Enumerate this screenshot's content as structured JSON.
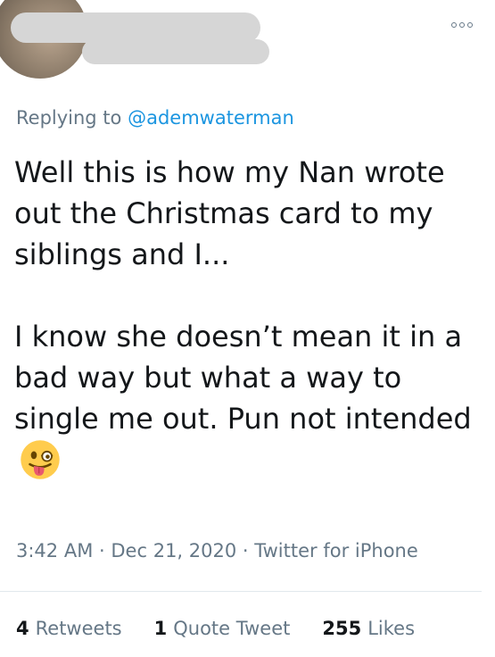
{
  "reply": {
    "prefix": "Replying to",
    "handle": "@ademwaterman"
  },
  "tweet": {
    "paragraph1": "Well this is how my Nan wrote out the Christmas card to my siblings and I...",
    "paragraph2": "I know she doesn’t mean it in a bad way but what a way to single me out. Pun not intended",
    "emoji": "winking-face-with-tongue"
  },
  "meta": {
    "time": "3:42 AM",
    "separator": "·",
    "date": "Dec 21, 2020",
    "source": "Twitter for iPhone"
  },
  "stats": {
    "retweets_count": "4",
    "retweets_label": "Retweets",
    "quotes_count": "1",
    "quotes_label": "Quote Tweet",
    "likes_count": "255",
    "likes_label": "Likes"
  },
  "icons": {
    "more": "more-options-icon"
  },
  "colors": {
    "link": "#1b95e0",
    "secondary_text": "#657786",
    "primary_text": "#14171a",
    "divider": "#e1e8ed"
  }
}
